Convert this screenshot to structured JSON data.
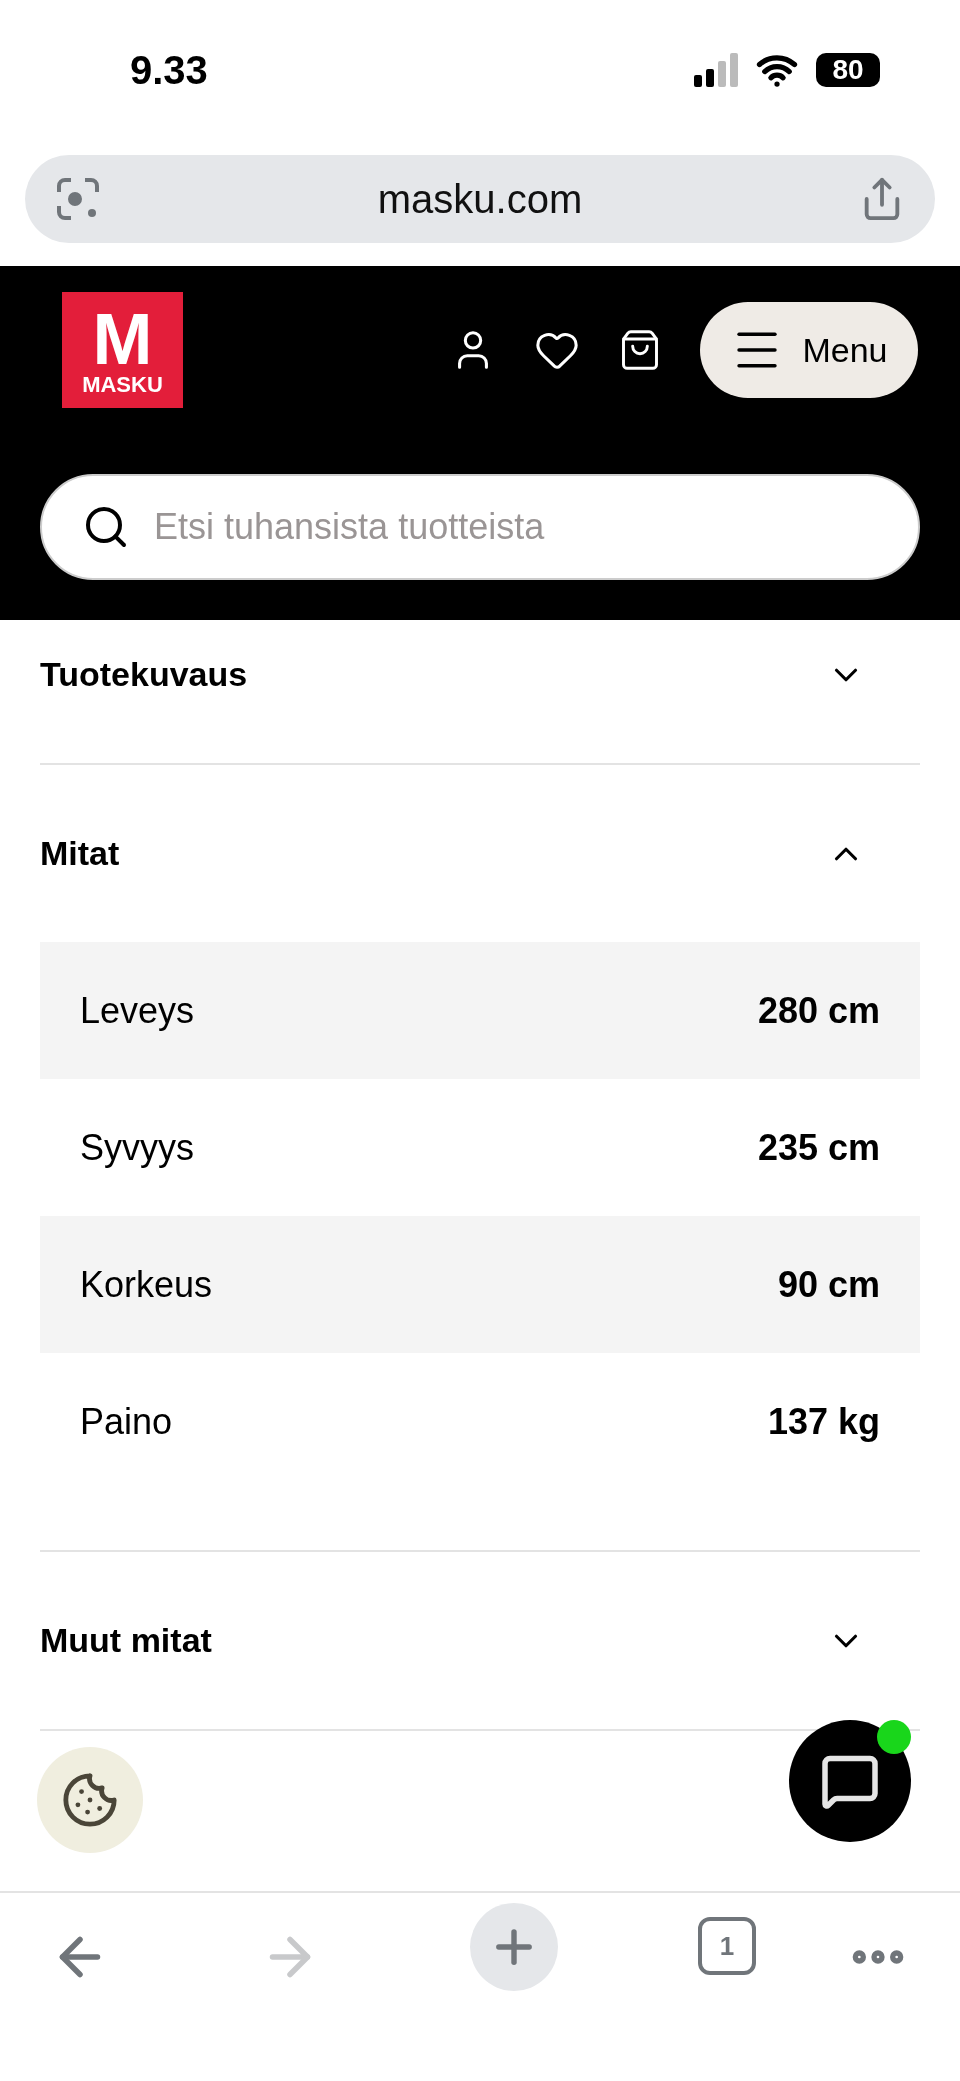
{
  "status_bar": {
    "time": "9.33",
    "battery": "80"
  },
  "browser": {
    "url": "masku.com",
    "tab_count": "1",
    "back_disabled": false,
    "forward_disabled": true
  },
  "header": {
    "logo": {
      "mark": "M",
      "wordmark": "MASKU"
    },
    "menu_button": "Menu",
    "search": {
      "placeholder": "Etsi tuhansista tuotteista"
    }
  },
  "accordion": [
    {
      "title": "Tuotekuvaus",
      "expanded": false
    },
    {
      "title": "Mitat",
      "expanded": true,
      "rows": [
        {
          "label": "Leveys",
          "value": "280 cm"
        },
        {
          "label": "Syvyys",
          "value": "235 cm"
        },
        {
          "label": "Korkeus",
          "value": "90 cm"
        },
        {
          "label": "Paino",
          "value": "137 kg"
        }
      ]
    },
    {
      "title": "Muut mitat",
      "expanded": false
    }
  ],
  "chat": {
    "online": true
  }
}
